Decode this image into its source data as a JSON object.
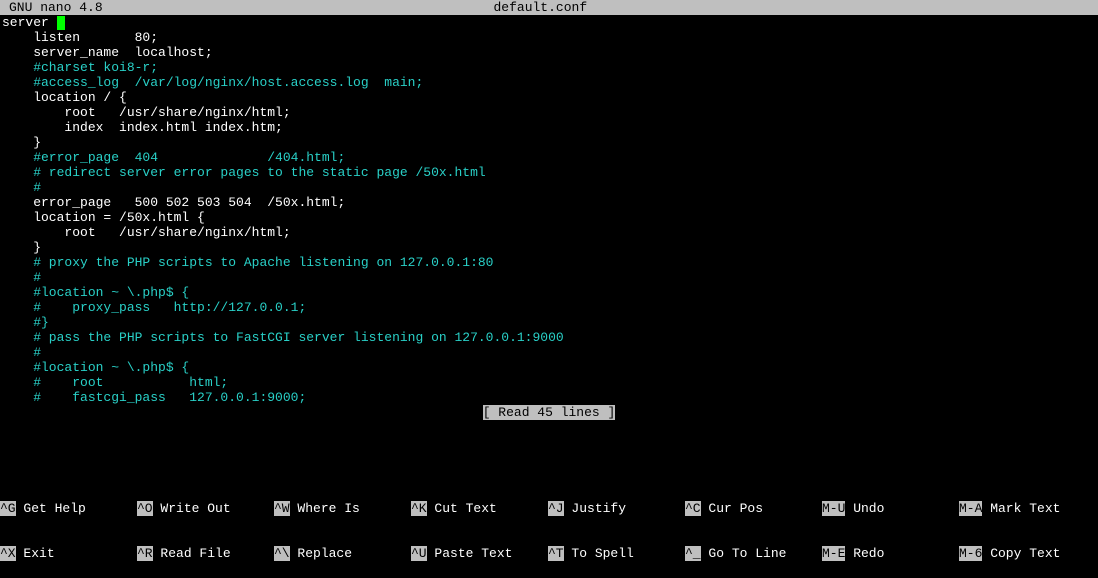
{
  "titlebar": {
    "app": "GNU nano 4.8",
    "filename": "default.conf"
  },
  "lines": [
    {
      "cls": "plain",
      "text": "server ",
      "cursor": true
    },
    {
      "cls": "plain",
      "text": "    listen       80;"
    },
    {
      "cls": "plain",
      "text": "    server_name  localhost;"
    },
    {
      "cls": "plain",
      "text": ""
    },
    {
      "cls": "cyan",
      "text": "    #charset koi8-r;"
    },
    {
      "cls": "cyan",
      "text": "    #access_log  /var/log/nginx/host.access.log  main;"
    },
    {
      "cls": "plain",
      "text": ""
    },
    {
      "cls": "plain",
      "text": "    location / {"
    },
    {
      "cls": "plain",
      "text": "        root   /usr/share/nginx/html;"
    },
    {
      "cls": "plain",
      "text": "        index  index.html index.htm;"
    },
    {
      "cls": "plain",
      "text": "    }"
    },
    {
      "cls": "plain",
      "text": ""
    },
    {
      "cls": "cyan",
      "text": "    #error_page  404              /404.html;"
    },
    {
      "cls": "plain",
      "text": ""
    },
    {
      "cls": "cyan",
      "text": "    # redirect server error pages to the static page /50x.html"
    },
    {
      "cls": "cyan",
      "text": "    #"
    },
    {
      "cls": "plain",
      "text": "    error_page   500 502 503 504  /50x.html;"
    },
    {
      "cls": "plain",
      "text": "    location = /50x.html {"
    },
    {
      "cls": "plain",
      "text": "        root   /usr/share/nginx/html;"
    },
    {
      "cls": "plain",
      "text": "    }"
    },
    {
      "cls": "plain",
      "text": ""
    },
    {
      "cls": "cyan",
      "text": "    # proxy the PHP scripts to Apache listening on 127.0.0.1:80"
    },
    {
      "cls": "cyan",
      "text": "    #"
    },
    {
      "cls": "cyan",
      "text": "    #location ~ \\.php$ {"
    },
    {
      "cls": "cyan",
      "text": "    #    proxy_pass   http://127.0.0.1;"
    },
    {
      "cls": "cyan",
      "text": "    #}"
    },
    {
      "cls": "plain",
      "text": ""
    },
    {
      "cls": "cyan",
      "text": "    # pass the PHP scripts to FastCGI server listening on 127.0.0.1:9000"
    },
    {
      "cls": "cyan",
      "text": "    #"
    },
    {
      "cls": "cyan",
      "text": "    #location ~ \\.php$ {"
    },
    {
      "cls": "cyan",
      "text": "    #    root           html;"
    },
    {
      "cls": "cyan",
      "text": "    #    fastcgi_pass   127.0.0.1:9000;"
    }
  ],
  "status": "[ Read 45 lines ]",
  "shortcuts": {
    "row1": [
      {
        "key": "^G",
        "label": " Get Help"
      },
      {
        "key": "^O",
        "label": " Write Out"
      },
      {
        "key": "^W",
        "label": " Where Is"
      },
      {
        "key": "^K",
        "label": " Cut Text"
      },
      {
        "key": "^J",
        "label": " Justify"
      },
      {
        "key": "^C",
        "label": " Cur Pos"
      },
      {
        "key": "M-U",
        "label": " Undo"
      },
      {
        "key": "M-A",
        "label": " Mark Text"
      }
    ],
    "row2": [
      {
        "key": "^X",
        "label": " Exit"
      },
      {
        "key": "^R",
        "label": " Read File"
      },
      {
        "key": "^\\",
        "label": " Replace"
      },
      {
        "key": "^U",
        "label": " Paste Text"
      },
      {
        "key": "^T",
        "label": " To Spell"
      },
      {
        "key": "^_",
        "label": " Go To Line"
      },
      {
        "key": "M-E",
        "label": " Redo"
      },
      {
        "key": "M-6",
        "label": " Copy Text"
      }
    ]
  }
}
